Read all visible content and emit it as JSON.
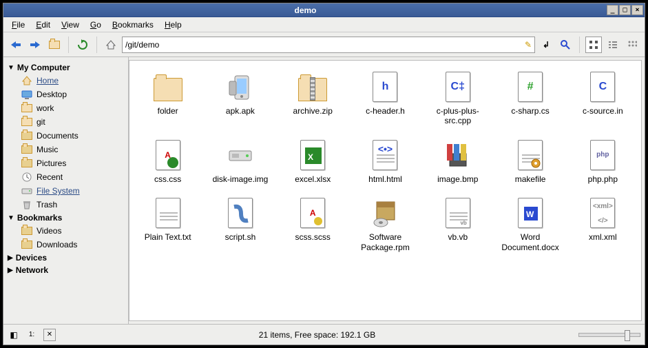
{
  "window": {
    "title": "demo"
  },
  "menu": {
    "file": "File",
    "edit": "Edit",
    "view": "View",
    "go": "Go",
    "bookmarks": "Bookmarks",
    "help": "Help"
  },
  "toolbar": {
    "path": "/git/demo"
  },
  "sidebar": {
    "groups": [
      {
        "label": "My Computer",
        "expanded": true,
        "items": [
          {
            "label": "Home",
            "icon": "home",
            "selected": true
          },
          {
            "label": "Desktop",
            "icon": "desktop"
          },
          {
            "label": "work",
            "icon": "folder"
          },
          {
            "label": "git",
            "icon": "folder"
          },
          {
            "label": "Documents",
            "icon": "folder-doc"
          },
          {
            "label": "Music",
            "icon": "folder-music"
          },
          {
            "label": "Pictures",
            "icon": "folder-pic"
          },
          {
            "label": "Recent",
            "icon": "recent"
          },
          {
            "label": "File System",
            "icon": "disk",
            "selected": true
          },
          {
            "label": "Trash",
            "icon": "trash"
          }
        ]
      },
      {
        "label": "Bookmarks",
        "expanded": true,
        "items": [
          {
            "label": "Videos",
            "icon": "folder-video"
          },
          {
            "label": "Downloads",
            "icon": "folder-down"
          }
        ]
      },
      {
        "label": "Devices",
        "expanded": false,
        "items": []
      },
      {
        "label": "Network",
        "expanded": false,
        "items": []
      }
    ]
  },
  "files": [
    {
      "name": "folder",
      "icon": "folder"
    },
    {
      "name": "apk.apk",
      "icon": "apk"
    },
    {
      "name": "archive.zip",
      "icon": "zip"
    },
    {
      "name": "c-header.h",
      "icon": "h",
      "glyph": "h",
      "color": "#2a4ad0"
    },
    {
      "name": "c-plus-plus-src.cpp",
      "icon": "cpp",
      "glyph": "C‡",
      "color": "#2a4ad0"
    },
    {
      "name": "c-sharp.cs",
      "icon": "cs",
      "glyph": "#",
      "color": "#2aa02a"
    },
    {
      "name": "c-source.in",
      "icon": "c",
      "glyph": "C",
      "color": "#2a4ad0"
    },
    {
      "name": "css.css",
      "icon": "css"
    },
    {
      "name": "disk-image.img",
      "icon": "disk"
    },
    {
      "name": "excel.xlsx",
      "icon": "excel"
    },
    {
      "name": "html.html",
      "icon": "html"
    },
    {
      "name": "image.bmp",
      "icon": "image"
    },
    {
      "name": "makefile",
      "icon": "makefile"
    },
    {
      "name": "php.php",
      "icon": "php"
    },
    {
      "name": "Plain Text.txt",
      "icon": "txt"
    },
    {
      "name": "script.sh",
      "icon": "sh"
    },
    {
      "name": "scss.scss",
      "icon": "scss"
    },
    {
      "name": "Software Package.rpm",
      "icon": "rpm"
    },
    {
      "name": "vb.vb",
      "icon": "vb"
    },
    {
      "name": "Word Document.docx",
      "icon": "word"
    },
    {
      "name": "xml.xml",
      "icon": "xml"
    }
  ],
  "status": {
    "text": "21 items, Free space: 192.1 GB"
  }
}
